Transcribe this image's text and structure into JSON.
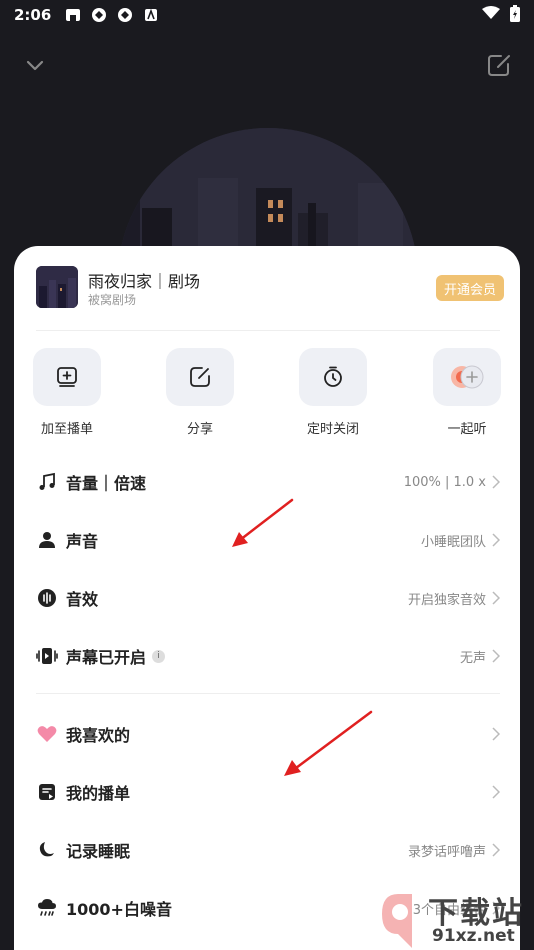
{
  "status_bar": {
    "time": "2:06"
  },
  "album": {
    "title": "雨夜归家｜剧场",
    "subtitle": "被窝剧场",
    "vip_label": "开通会员"
  },
  "quick_actions": [
    {
      "label": "加至播单",
      "icon": "add-to-playlist-icon"
    },
    {
      "label": "分享",
      "icon": "share-icon"
    },
    {
      "label": "定时关闭",
      "icon": "timer-icon"
    },
    {
      "label": "一起听",
      "icon": "listen-together-icon"
    }
  ],
  "menu": {
    "volume": {
      "label": "音量｜倍速",
      "value": "100% | 1.0 x"
    },
    "voice": {
      "label": "声音",
      "value": "小睡眠团队"
    },
    "sound_effect": {
      "label": "音效",
      "value": "开启独家音效"
    },
    "danmaku": {
      "label": "声幕已开启",
      "value": "无声"
    },
    "favorites": {
      "label": "我喜欢的"
    },
    "my_playlist": {
      "label": "我的播单"
    },
    "sleep_record": {
      "label": "记录睡眠",
      "value": "录梦话呼噜声"
    },
    "white_noise": {
      "label": "1000+白噪音",
      "value": "3个自由组合"
    }
  },
  "watermark": {
    "brand": "下载站",
    "url": "91xz.net"
  },
  "colors": {
    "vip": "#f0c273",
    "annotation_arrow": "#e02020",
    "background": "#1a1a1f"
  }
}
